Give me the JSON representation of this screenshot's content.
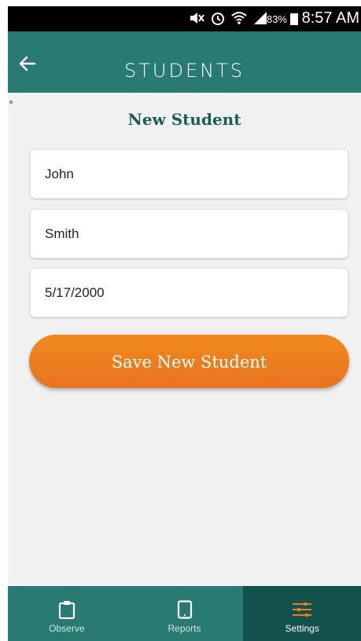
{
  "status_bar": {
    "battery": "83%",
    "time": "8:57 AM"
  },
  "header": {
    "title": "STUDENTS",
    "back_icon": "arrow-left-icon"
  },
  "form": {
    "heading": "New Student",
    "first_name": "John",
    "last_name": "Smith",
    "birth_date": "5/17/2000",
    "save_label": "Save New Student"
  },
  "nav": {
    "items": [
      {
        "label": "Observe",
        "icon": "clipboard-icon",
        "active": false
      },
      {
        "label": "Reports",
        "icon": "tablet-icon",
        "active": false
      },
      {
        "label": "Settings",
        "icon": "sliders-icon",
        "active": true
      }
    ]
  },
  "colors": {
    "primary": "#2a7a74",
    "primary_dark": "#13514d",
    "accent": "#ec7c1f",
    "heading": "#1d5d58"
  }
}
